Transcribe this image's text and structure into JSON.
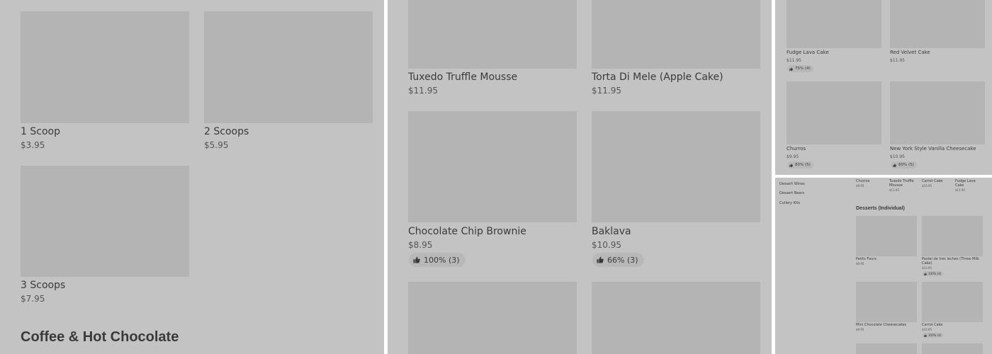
{
  "panel1": {
    "items": [
      {
        "name": "1 Scoop",
        "price": "$3.95"
      },
      {
        "name": "2 Scoops",
        "price": "$5.95"
      },
      {
        "name": "3 Scoops",
        "price": "$7.95"
      }
    ],
    "section_heading": "Coffee & Hot Chocolate"
  },
  "panel2": {
    "items": [
      {
        "name": "Tuxedo Truffle Mousse",
        "price": "$11.95"
      },
      {
        "name": "Torta Di Mele (Apple Cake)",
        "price": "$11.95"
      },
      {
        "name": "Chocolate Chip Brownie",
        "price": "$8.95",
        "rating": "100% (3)"
      },
      {
        "name": "Baklava",
        "price": "$10.95",
        "rating": "66% (3)"
      }
    ]
  },
  "panel3": {
    "items": [
      {
        "name": "Fudge Lava Cake",
        "price": "$11.95",
        "rating": "75% (4)"
      },
      {
        "name": "Red Velvet Cake",
        "price": "$11.95"
      },
      {
        "name": "Churros",
        "price": "$9.95",
        "rating": "80% (5)"
      },
      {
        "name": "New York Style Vanilla Cheesecake",
        "price": "$10.95",
        "rating": "80% (5)"
      }
    ]
  },
  "panel4": {
    "sidebar": [
      "Dessert Wines",
      "Dessert Beers",
      "Cutlery Kits"
    ],
    "top_items": [
      {
        "name": "Churros",
        "price": "$9.95"
      },
      {
        "name": "Tuxedo Truffle Mousse",
        "price": "$11.95"
      },
      {
        "name": "Carrot Cake",
        "price": "$10.95"
      },
      {
        "name": "Fudge Lava Cake",
        "price": "$11.95"
      }
    ],
    "section_heading": "Desserts (Individual)",
    "items": [
      {
        "name": "Petits Fours",
        "price": "$9.95"
      },
      {
        "name": "Pastel de tres leches (Three Milk Cake)",
        "price": "$10.95",
        "rating": "100% (4)"
      },
      {
        "name": "Mini Chocolate Cheesecakes",
        "price": "$9.95"
      },
      {
        "name": "Carrot Cake",
        "price": "$10.95",
        "rating": "100% (4)"
      }
    ]
  },
  "colors": {
    "panel_bg": "#c3c3c3",
    "tile_bg": "#b4b4b4",
    "pill_bg": "#b8b8b8",
    "text": "#3a3a3a"
  },
  "icons": {
    "rating": "thumbs-up-icon"
  }
}
